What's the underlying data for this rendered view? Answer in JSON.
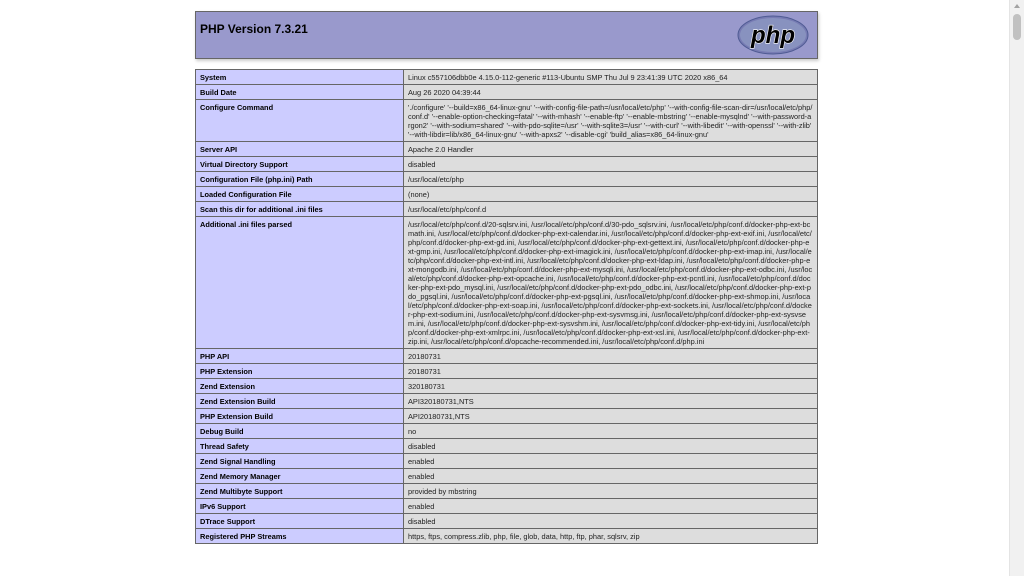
{
  "header": {
    "title": "PHP Version 7.3.21",
    "logo_text": "php"
  },
  "rows": [
    {
      "label": "System",
      "value": "Linux c557106dbb0e 4.15.0-112-generic #113-Ubuntu SMP Thu Jul 9 23:41:39 UTC 2020 x86_64"
    },
    {
      "label": "Build Date",
      "value": "Aug 26 2020 04:39:44"
    },
    {
      "label": "Configure Command",
      "value": "'./configure' '--build=x86_64-linux-gnu' '--with-config-file-path=/usr/local/etc/php' '--with-config-file-scan-dir=/usr/local/etc/php/conf.d' '--enable-option-checking=fatal' '--with-mhash' '--enable-ftp' '--enable-mbstring' '--enable-mysqlnd' '--with-password-argon2' '--with-sodium=shared' '--with-pdo-sqlite=/usr' '--with-sqlite3=/usr' '--with-curl' '--with-libedit' '--with-openssl' '--with-zlib' '--with-libdir=lib/x86_64-linux-gnu' '--with-apxs2' '--disable-cgi' 'build_alias=x86_64-linux-gnu'"
    },
    {
      "label": "Server API",
      "value": "Apache 2.0 Handler"
    },
    {
      "label": "Virtual Directory Support",
      "value": "disabled"
    },
    {
      "label": "Configuration File (php.ini) Path",
      "value": "/usr/local/etc/php"
    },
    {
      "label": "Loaded Configuration File",
      "value": "(none)"
    },
    {
      "label": "Scan this dir for additional .ini files",
      "value": "/usr/local/etc/php/conf.d"
    },
    {
      "label": "Additional .ini files parsed",
      "value": "/usr/local/etc/php/conf.d/20-sqlsrv.ini, /usr/local/etc/php/conf.d/30-pdo_sqlsrv.ini, /usr/local/etc/php/conf.d/docker-php-ext-bcmath.ini, /usr/local/etc/php/conf.d/docker-php-ext-calendar.ini, /usr/local/etc/php/conf.d/docker-php-ext-exif.ini, /usr/local/etc/php/conf.d/docker-php-ext-gd.ini, /usr/local/etc/php/conf.d/docker-php-ext-gettext.ini, /usr/local/etc/php/conf.d/docker-php-ext-gmp.ini, /usr/local/etc/php/conf.d/docker-php-ext-imagick.ini, /usr/local/etc/php/conf.d/docker-php-ext-imap.ini, /usr/local/etc/php/conf.d/docker-php-ext-intl.ini, /usr/local/etc/php/conf.d/docker-php-ext-ldap.ini, /usr/local/etc/php/conf.d/docker-php-ext-mongodb.ini, /usr/local/etc/php/conf.d/docker-php-ext-mysqli.ini, /usr/local/etc/php/conf.d/docker-php-ext-odbc.ini, /usr/local/etc/php/conf.d/docker-php-ext-opcache.ini, /usr/local/etc/php/conf.d/docker-php-ext-pcntl.ini, /usr/local/etc/php/conf.d/docker-php-ext-pdo_mysql.ini, /usr/local/etc/php/conf.d/docker-php-ext-pdo_odbc.ini, /usr/local/etc/php/conf.d/docker-php-ext-pdo_pgsql.ini, /usr/local/etc/php/conf.d/docker-php-ext-pgsql.ini, /usr/local/etc/php/conf.d/docker-php-ext-shmop.ini, /usr/local/etc/php/conf.d/docker-php-ext-soap.ini, /usr/local/etc/php/conf.d/docker-php-ext-sockets.ini, /usr/local/etc/php/conf.d/docker-php-ext-sodium.ini, /usr/local/etc/php/conf.d/docker-php-ext-sysvmsg.ini, /usr/local/etc/php/conf.d/docker-php-ext-sysvsem.ini, /usr/local/etc/php/conf.d/docker-php-ext-sysvshm.ini, /usr/local/etc/php/conf.d/docker-php-ext-tidy.ini, /usr/local/etc/php/conf.d/docker-php-ext-xmlrpc.ini, /usr/local/etc/php/conf.d/docker-php-ext-xsl.ini, /usr/local/etc/php/conf.d/docker-php-ext-zip.ini, /usr/local/etc/php/conf.d/opcache-recommended.ini, /usr/local/etc/php/conf.d/php.ini"
    },
    {
      "label": "PHP API",
      "value": "20180731"
    },
    {
      "label": "PHP Extension",
      "value": "20180731"
    },
    {
      "label": "Zend Extension",
      "value": "320180731"
    },
    {
      "label": "Zend Extension Build",
      "value": "API320180731,NTS"
    },
    {
      "label": "PHP Extension Build",
      "value": "API20180731,NTS"
    },
    {
      "label": "Debug Build",
      "value": "no"
    },
    {
      "label": "Thread Safety",
      "value": "disabled"
    },
    {
      "label": "Zend Signal Handling",
      "value": "enabled"
    },
    {
      "label": "Zend Memory Manager",
      "value": "enabled"
    },
    {
      "label": "Zend Multibyte Support",
      "value": "provided by mbstring"
    },
    {
      "label": "IPv6 Support",
      "value": "enabled"
    },
    {
      "label": "DTrace Support",
      "value": "disabled"
    },
    {
      "label": "Registered PHP Streams",
      "value": "https, ftps, compress.zlib, php, file, glob, data, http, ftp, phar, sqlsrv, zip"
    }
  ],
  "colors": {
    "header_bg": "#9999cc",
    "label_bg": "#ccccff",
    "value_bg": "#dddddd"
  }
}
